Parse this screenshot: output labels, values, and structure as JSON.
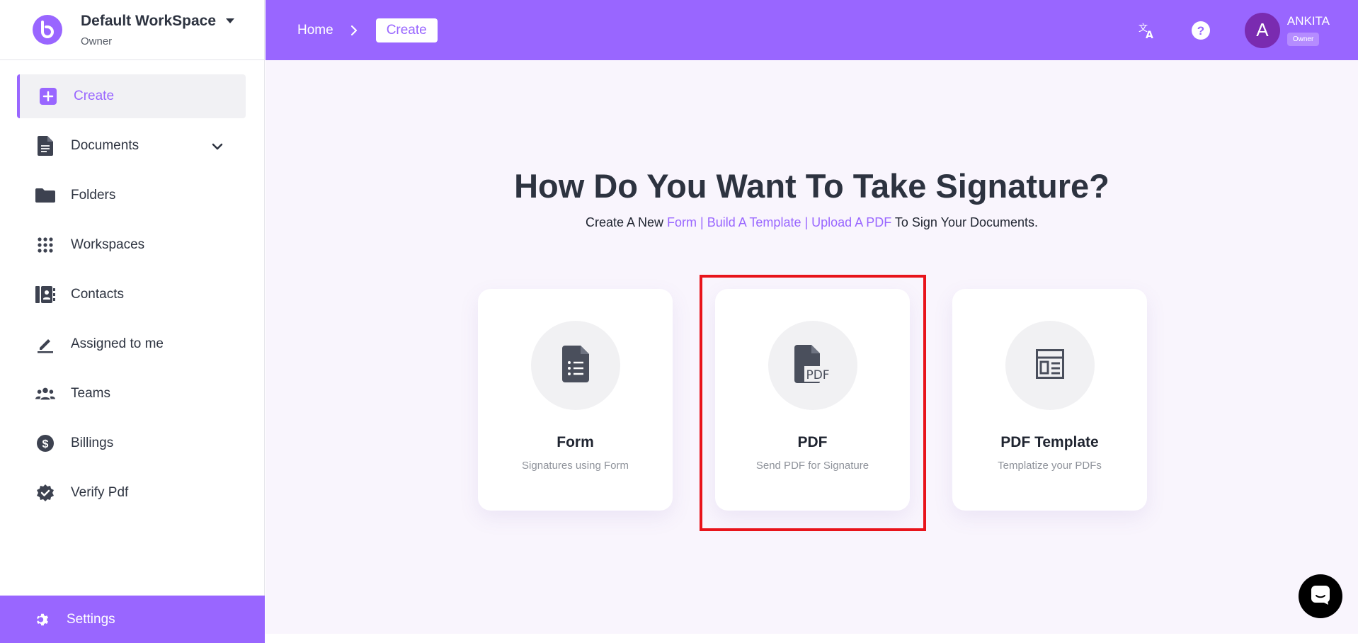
{
  "workspace": {
    "name": "Default WorkSpace",
    "role": "Owner"
  },
  "sidebar": {
    "items": [
      {
        "label": "Create",
        "icon": "plus-square-icon"
      },
      {
        "label": "Documents",
        "icon": "document-icon"
      },
      {
        "label": "Folders",
        "icon": "folder-icon"
      },
      {
        "label": "Workspaces",
        "icon": "grid-dots-icon"
      },
      {
        "label": "Contacts",
        "icon": "address-book-icon"
      },
      {
        "label": "Assigned to me",
        "icon": "pen-icon"
      },
      {
        "label": "Teams",
        "icon": "users-icon"
      },
      {
        "label": "Billings",
        "icon": "dollar-icon"
      },
      {
        "label": "Verify Pdf",
        "icon": "badge-check-icon"
      }
    ],
    "settings_label": "Settings"
  },
  "breadcrumb": {
    "home": "Home",
    "current": "Create"
  },
  "user": {
    "initial": "A",
    "name": "ANKITA",
    "role": "Owner"
  },
  "main": {
    "headline": "How Do You Want To Take Signature?",
    "sub_prefix": "Create A New ",
    "sub_highlight": "Form | Build A Template | Upload A PDF",
    "sub_suffix": " To Sign Your Documents.",
    "cards": [
      {
        "title": "Form",
        "subtitle": "Signatures using Form",
        "icon": "form-document-icon"
      },
      {
        "title": "PDF",
        "subtitle": "Send PDF for Signature",
        "icon": "pdf-file-icon"
      },
      {
        "title": "PDF Template",
        "subtitle": "Templatize your PDFs",
        "icon": "template-layout-icon"
      }
    ]
  },
  "colors": {
    "accent": "#9966ff",
    "highlight_border": "#e8141b",
    "main_bg": "#f9f5fd",
    "avatar": "#7a2bb0"
  }
}
